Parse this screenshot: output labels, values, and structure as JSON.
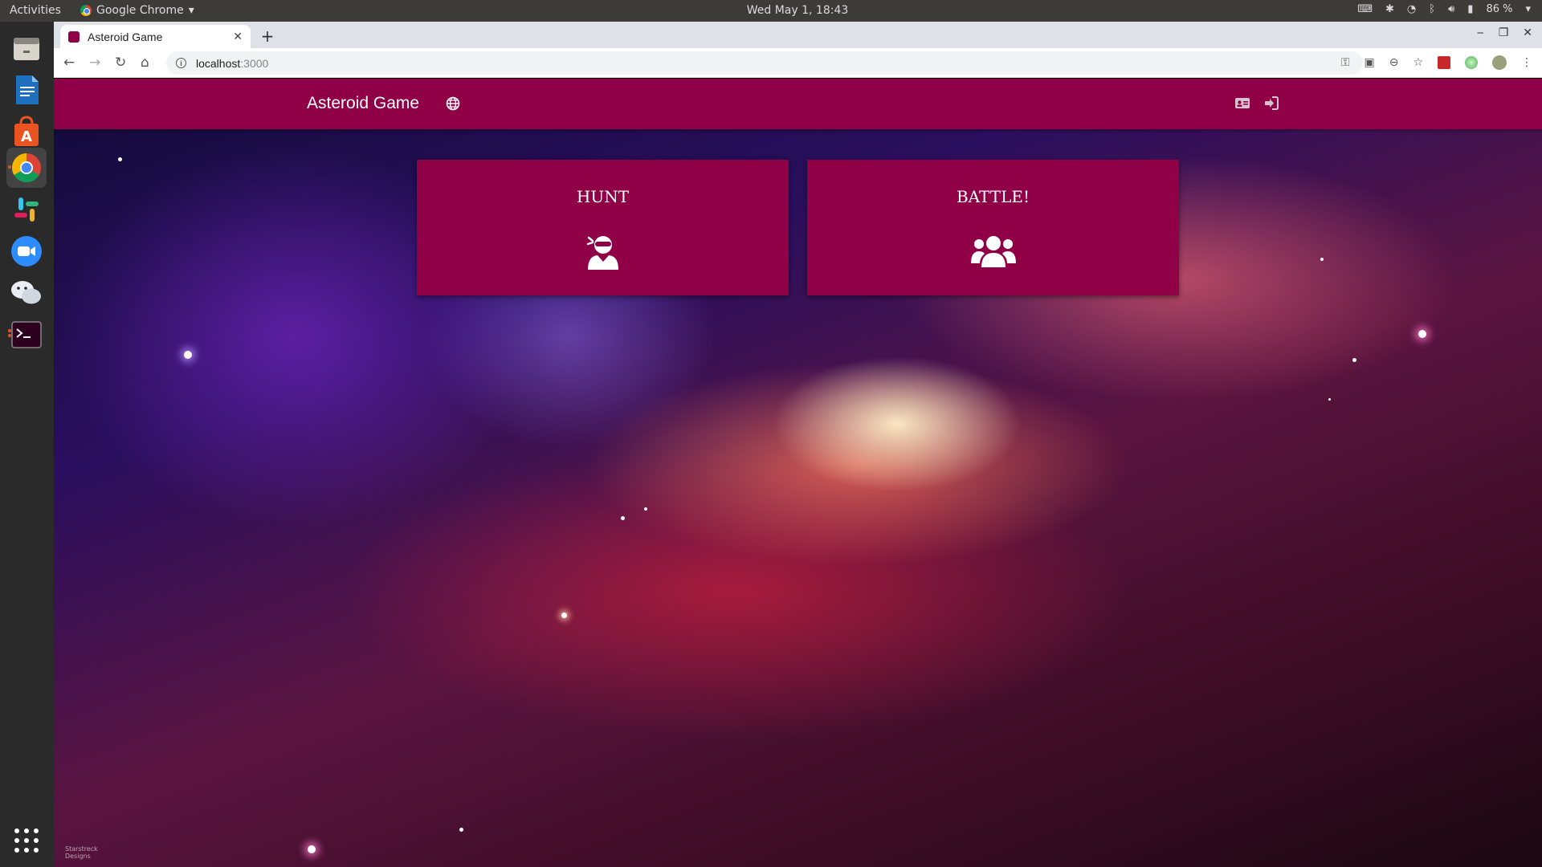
{
  "system_bar": {
    "activities": "Activities",
    "app_menu": "Google Chrome",
    "clock": "Wed May  1, 18:43",
    "battery": "86 %"
  },
  "browser": {
    "tab_title": "Asteroid Game",
    "url_host": "localhost",
    "url_port": ":3000"
  },
  "app": {
    "title": "Asteroid Game",
    "brand_color": "#8f0046",
    "header_icons": [
      "globe-icon",
      "id-card-icon",
      "sign-in-icon"
    ]
  },
  "modes": [
    {
      "label": "HUNT",
      "icon": "user-ninja-icon"
    },
    {
      "label": "BATTLE!",
      "icon": "users-icon"
    }
  ],
  "background": {
    "watermark_line1": "Starstreck",
    "watermark_line2": "Designs"
  }
}
